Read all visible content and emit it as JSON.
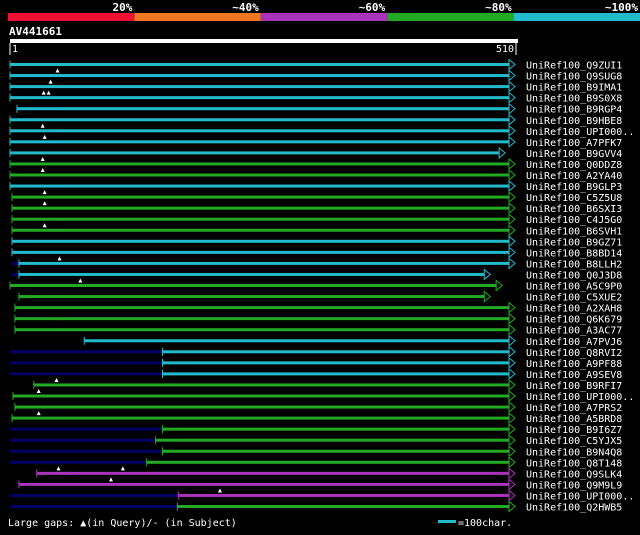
{
  "colors": {
    "background": "#000000",
    "text": "#ffffff",
    "legend": [
      "#ee1133",
      "#ee7722",
      "#aa33bb",
      "#22aa22",
      "#22bbcc"
    ],
    "query_bar": "#ffffff",
    "gap": "#000066",
    "marker": "#ffffff"
  },
  "legend": {
    "labels": [
      "20%",
      "~40%",
      "~60%",
      "~80%",
      "~100%"
    ]
  },
  "query": {
    "name": "AV441661",
    "start_label": "1",
    "end_label": "510",
    "length": 510
  },
  "footer": {
    "gaps_label": "Large gaps: ▲(in Query)/- (in Subject)",
    "scale_label": "=100char."
  },
  "hits": [
    {
      "name": "UniRef100_Q9ZUI1",
      "bin": 4,
      "start": 1,
      "end": 510,
      "arrow": true,
      "gaps": [],
      "markers": []
    },
    {
      "name": "UniRef100_Q9SUG8",
      "bin": 4,
      "start": 1,
      "end": 510,
      "arrow": true,
      "gaps": [],
      "markers": [
        49
      ]
    },
    {
      "name": "UniRef100_B9IMA1",
      "bin": 4,
      "start": 1,
      "end": 510,
      "arrow": true,
      "gaps": [],
      "markers": [
        42
      ]
    },
    {
      "name": "UniRef100_B9S0X8",
      "bin": 4,
      "start": 1,
      "end": 510,
      "arrow": true,
      "gaps": [],
      "markers": [
        35,
        40
      ]
    },
    {
      "name": "UniRef100_B9RGP4",
      "bin": 4,
      "start": 8,
      "end": 510,
      "arrow": true,
      "gaps": [
        [
          8,
          50
        ]
      ],
      "markers": []
    },
    {
      "name": "UniRef100_B9HBE8",
      "bin": 4,
      "start": 1,
      "end": 510,
      "arrow": true,
      "gaps": [],
      "markers": []
    },
    {
      "name": "UniRef100_UPI000..",
      "bin": 4,
      "start": 1,
      "end": 510,
      "arrow": true,
      "gaps": [
        [
          40,
          50
        ]
      ],
      "markers": [
        34
      ]
    },
    {
      "name": "UniRef100_A7PFK7",
      "bin": 4,
      "start": 1,
      "end": 510,
      "arrow": true,
      "gaps": [
        [
          30,
          50
        ]
      ],
      "markers": [
        36
      ]
    },
    {
      "name": "UniRef100_B9GVV4",
      "bin": 4,
      "start": 1,
      "end": 500,
      "arrow": true,
      "gaps": [],
      "markers": []
    },
    {
      "name": "UniRef100_Q0DDZ8",
      "bin": 3,
      "start": 1,
      "end": 510,
      "arrow": true,
      "gaps": [],
      "markers": [
        34
      ]
    },
    {
      "name": "UniRef100_A2YA40",
      "bin": 3,
      "start": 1,
      "end": 510,
      "arrow": true,
      "gaps": [],
      "markers": [
        34
      ]
    },
    {
      "name": "UniRef100_B9GLP3",
      "bin": 4,
      "start": 1,
      "end": 510,
      "arrow": true,
      "gaps": [
        [
          46,
          50
        ]
      ],
      "markers": []
    },
    {
      "name": "UniRef100_C5Z5U8",
      "bin": 3,
      "start": 3,
      "end": 510,
      "arrow": true,
      "gaps": [],
      "markers": [
        36
      ]
    },
    {
      "name": "UniRef100_B6SXI3",
      "bin": 3,
      "start": 3,
      "end": 510,
      "arrow": true,
      "gaps": [],
      "markers": [
        36
      ]
    },
    {
      "name": "UniRef100_C4J5G0",
      "bin": 3,
      "start": 3,
      "end": 510,
      "arrow": true,
      "gaps": [
        [
          48,
          54
        ]
      ],
      "markers": []
    },
    {
      "name": "UniRef100_B6SVH1",
      "bin": 3,
      "start": 3,
      "end": 510,
      "arrow": true,
      "gaps": [
        [
          48,
          54
        ]
      ],
      "markers": [
        36
      ]
    },
    {
      "name": "UniRef100_B9GZ71",
      "bin": 4,
      "start": 3,
      "end": 510,
      "arrow": true,
      "gaps": [
        [
          3,
          10
        ]
      ],
      "markers": []
    },
    {
      "name": "UniRef100_B8BD14",
      "bin": 4,
      "start": 3,
      "end": 510,
      "arrow": true,
      "gaps": [
        [
          3,
          10
        ]
      ],
      "markers": []
    },
    {
      "name": "UniRef100_B8LLH2",
      "bin": 4,
      "start": 10,
      "end": 510,
      "arrow": true,
      "gaps": [
        [
          3,
          10
        ]
      ],
      "markers": [
        51
      ]
    },
    {
      "name": "UniRef100_Q0J3D8",
      "bin": 4,
      "start": 10,
      "end": 485,
      "arrow": true,
      "gaps": [
        [
          3,
          10
        ]
      ],
      "markers": []
    },
    {
      "name": "UniRef100_A5C9P0",
      "bin": 3,
      "start": 1,
      "end": 497,
      "arrow": true,
      "gaps": [],
      "markers": [
        72
      ]
    },
    {
      "name": "UniRef100_C5XUE2",
      "bin": 3,
      "start": 10,
      "end": 485,
      "arrow": true,
      "gaps": [
        [
          40,
          55
        ]
      ],
      "markers": []
    },
    {
      "name": "UniRef100_A2XAH8",
      "bin": 3,
      "start": 6,
      "end": 510,
      "arrow": true,
      "gaps": [
        [
          48,
          54
        ]
      ],
      "markers": []
    },
    {
      "name": "UniRef100_Q6K679",
      "bin": 3,
      "start": 6,
      "end": 510,
      "arrow": true,
      "gaps": [
        [
          48,
          54
        ]
      ],
      "markers": []
    },
    {
      "name": "UniRef100_A3AC77",
      "bin": 3,
      "start": 6,
      "end": 510,
      "arrow": true,
      "gaps": [
        [
          48,
          54
        ]
      ],
      "markers": []
    },
    {
      "name": "UniRef100_A7PVJ6",
      "bin": 4,
      "start": 76,
      "end": 510,
      "arrow": true,
      "gaps": [],
      "markers": []
    },
    {
      "name": "UniRef100_Q8RVI2",
      "bin": 4,
      "start": 155,
      "end": 510,
      "arrow": true,
      "gaps": [
        [
          1,
          155
        ]
      ],
      "markers": []
    },
    {
      "name": "UniRef100_A9PF88",
      "bin": 4,
      "start": 155,
      "end": 510,
      "arrow": true,
      "gaps": [
        [
          1,
          155
        ]
      ],
      "markers": []
    },
    {
      "name": "UniRef100_A9SEV8",
      "bin": 4,
      "start": 155,
      "end": 510,
      "arrow": true,
      "gaps": [
        [
          1,
          155
        ]
      ],
      "markers": []
    },
    {
      "name": "UniRef100_B9RFI7",
      "bin": 3,
      "start": 25,
      "end": 510,
      "arrow": true,
      "gaps": [
        [
          65,
          75
        ]
      ],
      "markers": [
        48
      ]
    },
    {
      "name": "UniRef100_UPI000..",
      "bin": 3,
      "start": 4,
      "end": 510,
      "arrow": true,
      "gaps": [],
      "markers": [
        30
      ]
    },
    {
      "name": "UniRef100_A7PRS2",
      "bin": 3,
      "start": 6,
      "end": 510,
      "arrow": true,
      "gaps": [
        [
          50,
          56
        ]
      ],
      "markers": []
    },
    {
      "name": "UniRef100_A5BRD8",
      "bin": 3,
      "start": 3,
      "end": 510,
      "arrow": true,
      "gaps": [],
      "markers": [
        30
      ]
    },
    {
      "name": "UniRef100_B9I6Z7",
      "bin": 3,
      "start": 155,
      "end": 510,
      "arrow": true,
      "gaps": [
        [
          1,
          155
        ]
      ],
      "markers": []
    },
    {
      "name": "UniRef100_C5YJX5",
      "bin": 3,
      "start": 148,
      "end": 510,
      "arrow": true,
      "gaps": [
        [
          1,
          148
        ]
      ],
      "markers": []
    },
    {
      "name": "UniRef100_B9N4Q8",
      "bin": 3,
      "start": 155,
      "end": 510,
      "arrow": true,
      "gaps": [
        [
          1,
          155
        ]
      ],
      "markers": []
    },
    {
      "name": "UniRef100_Q8T148",
      "bin": 3,
      "start": 139,
      "end": 510,
      "arrow": true,
      "gaps": [
        [
          1,
          139
        ]
      ],
      "markers": []
    },
    {
      "name": "UniRef100_Q9SLK4",
      "bin": 2,
      "start": 28,
      "end": 510,
      "arrow": true,
      "gaps": [
        [
          55,
          65
        ]
      ],
      "markers": [
        50,
        115
      ]
    },
    {
      "name": "UniRef100_Q9M9L9",
      "bin": 2,
      "start": 10,
      "end": 510,
      "arrow": true,
      "gaps": [
        [
          55,
          65
        ]
      ],
      "markers": [
        103
      ]
    },
    {
      "name": "UniRef100_UPI000..",
      "bin": 2,
      "start": 171,
      "end": 510,
      "arrow": true,
      "gaps": [
        [
          1,
          171
        ]
      ],
      "markers": [
        213
      ]
    },
    {
      "name": "UniRef100_Q2HWB5",
      "bin": 3,
      "start": 170,
      "end": 510,
      "arrow": true,
      "gaps": [
        [
          1,
          170
        ],
        [
          255,
          265
        ]
      ],
      "markers": []
    }
  ]
}
